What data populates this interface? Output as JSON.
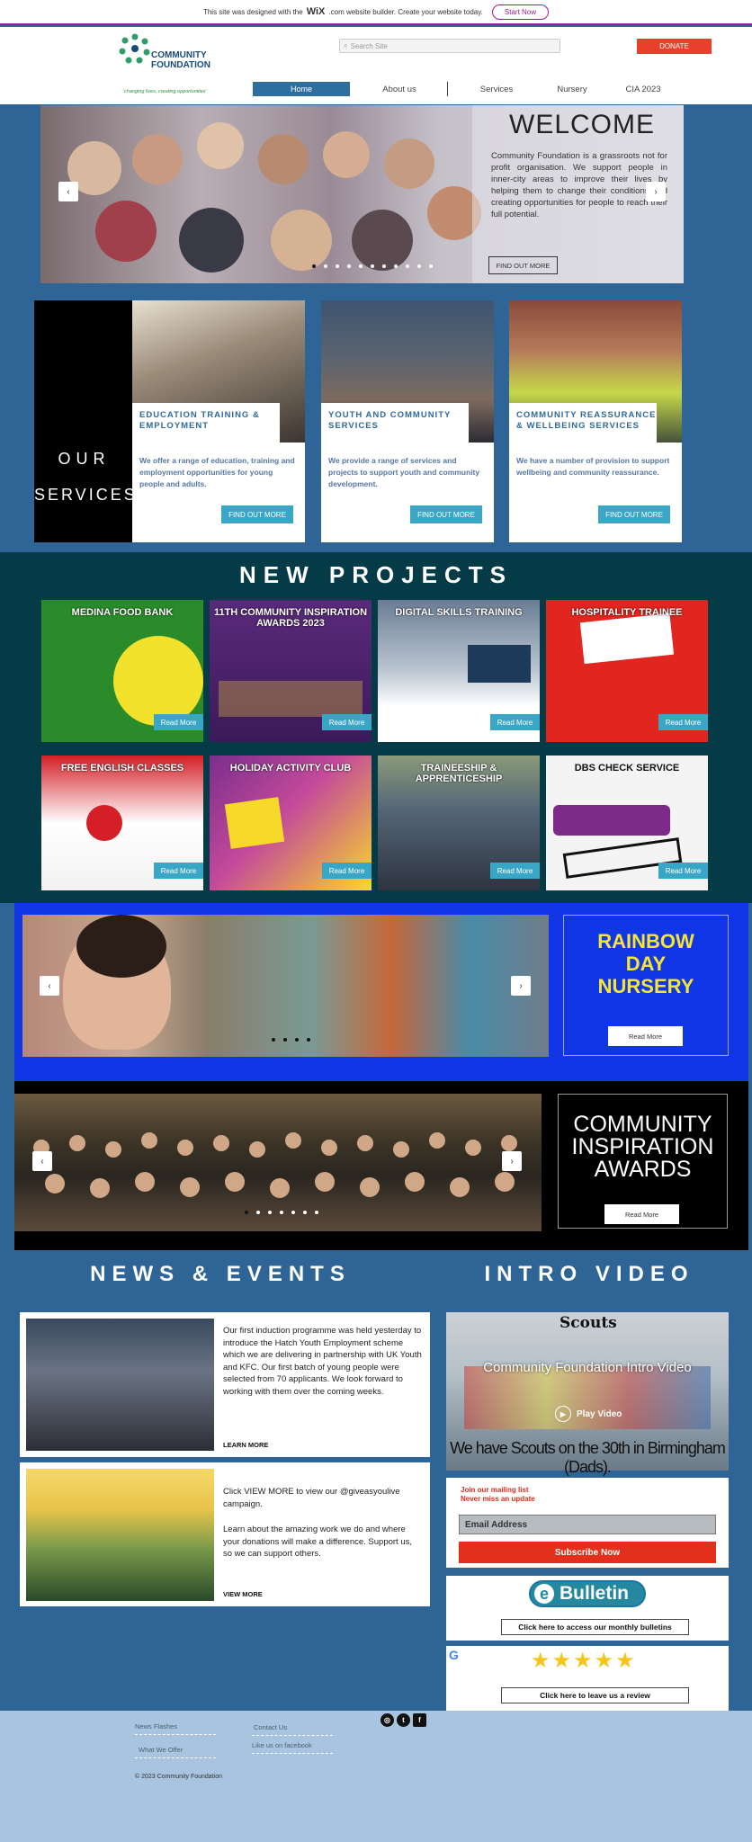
{
  "wix_banner": {
    "pre": "This site was designed with the",
    "brand": "WiX",
    "post": ".com website builder. Create your website today.",
    "button": "Start Now"
  },
  "header": {
    "logo_line1": "COMMUNITY",
    "logo_line2": "FOUNDATION",
    "tagline": "'changing lives, creating opportunities'",
    "search_placeholder": "Search Site",
    "social": [
      {
        "icon": "instagram-icon",
        "glyph": "◎",
        "color": "#c13584"
      },
      {
        "icon": "facebook-icon",
        "glyph": "f",
        "color": "#3b5998"
      },
      {
        "icon": "twitter-icon",
        "glyph": "t",
        "color": "#1da1f2"
      }
    ],
    "donate": "DONATE",
    "nav": [
      "Home",
      "About us",
      "Services",
      "Nursery",
      "CIA 2023"
    ]
  },
  "hero": {
    "title": "WELCOME",
    "text": "Community Foundation is a grassroots not for profit organisation. We support people in inner-city areas to improve their lives by helping them to change their conditions and creating opportunities for people to reach their full potential.",
    "button": "FIND OUT MORE",
    "prev": "‹",
    "next": "›"
  },
  "services": {
    "heading_line1": "OUR",
    "heading_line2": "SERVICES",
    "cards": [
      {
        "title": "EDUCATION TRAINING & EMPLOYMENT",
        "desc": "We offer a range of education, training and employment opportunities for young people and adults.",
        "button": "FIND OUT MORE"
      },
      {
        "title": "YOUTH AND COMMUNITY SERVICES",
        "desc": "We provide a range of services and projects to support youth and community development.",
        "button": "FIND OUT MORE"
      },
      {
        "title": "COMMUNITY REASSURANCE & WELLBEING SERVICES",
        "desc": "We have a number of provision to support wellbeing and community reassurance.",
        "button": "FIND OUT MORE"
      }
    ]
  },
  "new_projects": {
    "title": "NEW PROJECTS",
    "items": [
      {
        "title": "MEDINA FOOD BANK",
        "bg": "#2a8b2a",
        "accent": "#f2e22c",
        "button": "Read More"
      },
      {
        "title": "11TH COMMUNITY INSPIRATION AWARDS 2023",
        "bg": "#5a2a7a",
        "accent": "#e8c23a",
        "button": "Read More"
      },
      {
        "title": "DIGITAL SKILLS TRAINING",
        "bg": "#9aa7b8",
        "accent": "#ffffff",
        "button": "Read More"
      },
      {
        "title": "HOSPITALITY TRAINEE",
        "bg": "#e0261e",
        "accent": "#ffffff",
        "button": "Read More"
      },
      {
        "title": "FREE ENGLISH CLASSES",
        "bg": "#d41f26",
        "accent": "#ffffff",
        "button": "Read More"
      },
      {
        "title": "HOLIDAY ACTIVITY CLUB",
        "bg": "#7a2e8c",
        "accent": "#f7d92a",
        "button": "Read More"
      },
      {
        "title": "TRAINEESHIP & APPRENTICESHIP",
        "bg": "#556677",
        "accent": "#e3e3e3",
        "button": "Read More"
      },
      {
        "title": "DBS CHECK SERVICE",
        "bg": "#f4f4f4",
        "accent": "#7b2a8a",
        "button": "Read More"
      }
    ]
  },
  "nursery": {
    "line1": "RAINBOW",
    "line2": "DAY",
    "line3": "NURSERY",
    "button": "Read More"
  },
  "awards": {
    "line1": "COMMUNITY",
    "line2": "INSPIRATION",
    "line3": "AWARDS",
    "button": "Read More"
  },
  "news": {
    "title": "NEWS & EVENTS",
    "items": [
      {
        "text": "Our first induction programme was held yesterday to introduce the Hatch Youth Employment scheme which we are delivering in partnership with UK Youth and KFC. Our first batch of young people were selected from 70 applicants.   We look forward to working with them over the coming weeks.",
        "link": "LEARN MORE"
      },
      {
        "text": "Click VIEW MORE to view our @giveasyoulive campaign.",
        "text2": "Learn about the amazing work we do and where your donations will make a difference. Support us, so we can support others.",
        "link": "VIEW MORE"
      }
    ]
  },
  "video": {
    "title": "INTRO VIDEO",
    "scouts": "Scouts",
    "caption": "Community Foundation Intro Video",
    "play": "Play Video",
    "subtitle": "We have Scouts on the 30th in Birmingham (Dads)."
  },
  "mailing": {
    "line1": "Join our mailing list",
    "line2": "Never miss an update",
    "placeholder": "Email Address",
    "button": "Subscribe Now"
  },
  "bulletin": {
    "logo_e": "e",
    "logo": "Bulletin",
    "link": "Click here to access our monthly bulletins"
  },
  "review": {
    "g": "G",
    "stars": "★★★★★",
    "link": "Click here to leave us a review"
  },
  "footer": {
    "news_flashes": "News Flashes",
    "what_we_offer": "What We Offer",
    "contact_us": "Contact Us",
    "like_us": "Like us on facebook",
    "copyright": "© 2023 Community Foundation",
    "social": [
      {
        "icon": "instagram-icon",
        "glyph": "◎"
      },
      {
        "icon": "twitter-icon",
        "glyph": "t"
      },
      {
        "icon": "facebook-icon",
        "glyph": "f"
      }
    ]
  },
  "colors": {
    "brand_blue": "#2f6497",
    "teal_button": "#3aa6c6",
    "donate_red": "#e8402a",
    "nursery_blue": "#1136e6",
    "projects_band": "#053b46",
    "footer": "#a8c4e0"
  }
}
